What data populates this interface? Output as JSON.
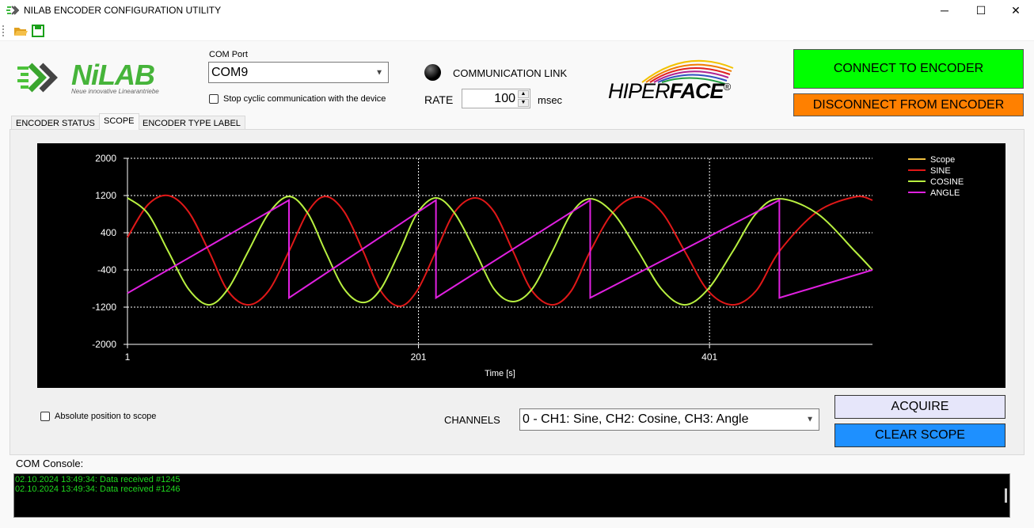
{
  "window": {
    "title": "NILAB ENCODER CONFIGURATION UTILITY",
    "minimize": "─",
    "maximize": "☐",
    "close": "✕"
  },
  "toolbar": {
    "open_icon": "folder-open-icon",
    "save_icon": "save-disk-icon"
  },
  "logo": {
    "text": "NiLAB",
    "tagline": "Neue innovative Linearantriebe"
  },
  "com": {
    "label": "COM Port",
    "value": "COM9",
    "stop_cyclic_label": "Stop cyclic communication with the device",
    "stop_cyclic_checked": false
  },
  "link": {
    "label": "COMMUNICATION LINK",
    "rate_label": "RATE",
    "rate_value": "100",
    "rate_unit": "msec"
  },
  "brand": {
    "text_light": "HIPER",
    "text_bold": "FACE",
    "reg": "®"
  },
  "buttons": {
    "connect": "CONNECT TO ENCODER",
    "disconnect": "DISCONNECT FROM ENCODER",
    "acquire": "ACQUIRE",
    "clear": "CLEAR SCOPE",
    "connect_color": "#00ff00",
    "disconnect_color": "#ff8000",
    "clear_color": "#1e90ff"
  },
  "tabs": [
    {
      "label": "ENCODER STATUS"
    },
    {
      "label": "SCOPE",
      "active": true
    },
    {
      "label": "ENCODER TYPE LABEL"
    }
  ],
  "scope": {
    "absolute_label": "Absolute position to scope",
    "absolute_checked": false,
    "channels_label": "CHANNELS",
    "channels_value": "0 - CH1: Sine, CH2: Cosine, CH3: Angle"
  },
  "console": {
    "label": "COM Console:",
    "lines": [
      "02.10.2024 13:49:34: Data received #1245",
      "02.10.2024 13:49:34: Data received #1246"
    ]
  },
  "chart_data": {
    "type": "line",
    "xlabel": "Time [s]",
    "ylabel": "",
    "xlim": [
      1,
      513
    ],
    "ylim": [
      -2000,
      2000
    ],
    "yticks": [
      "2000",
      "1200",
      "400",
      "-400",
      "-1200",
      "-2000"
    ],
    "xticks": [
      "1",
      "201",
      "401"
    ],
    "legend_position": "top-right",
    "grid": true,
    "series": [
      {
        "name": "Scope",
        "color": "#f0c040",
        "x": [],
        "y": []
      },
      {
        "name": "SINE",
        "color": "#e01818",
        "x": [
          1,
          15,
          29,
          43,
          57,
          70,
          84,
          98,
          112,
          125,
          137,
          150,
          163,
          175,
          188,
          200,
          213,
          226,
          240,
          253,
          266,
          279,
          293,
          306,
          319,
          335,
          352,
          368,
          384,
          400,
          417,
          433,
          449,
          475,
          501,
          513
        ],
        "y": [
          300,
          1000,
          1200,
          849,
          0,
          -849,
          -1150,
          -849,
          0,
          849,
          1180,
          849,
          0,
          -849,
          -1180,
          -849,
          0,
          849,
          1150,
          849,
          0,
          -849,
          -1150,
          -849,
          0,
          849,
          1170,
          849,
          0,
          -849,
          -1150,
          -849,
          0,
          849,
          1170,
          1100
        ]
      },
      {
        "name": "COSINE",
        "color": "#b8f040",
        "x": [
          1,
          15,
          29,
          43,
          57,
          70,
          84,
          98,
          112,
          125,
          137,
          150,
          163,
          175,
          188,
          200,
          213,
          226,
          240,
          253,
          266,
          279,
          293,
          306,
          319,
          335,
          352,
          368,
          384,
          400,
          417,
          433,
          449,
          475,
          501,
          513
        ],
        "y": [
          1150,
          813,
          0,
          -813,
          -1150,
          -813,
          0,
          813,
          1180,
          813,
          0,
          -813,
          -1100,
          -813,
          0,
          813,
          1150,
          813,
          0,
          -813,
          -1080,
          -813,
          0,
          813,
          1130,
          813,
          0,
          -813,
          -1150,
          -813,
          0,
          813,
          1130,
          813,
          0,
          -400
        ]
      },
      {
        "name": "ANGLE",
        "color": "#e020e0",
        "x": [
          1,
          112,
          112,
          213,
          213,
          319,
          319,
          449,
          449,
          513
        ],
        "y": [
          -900,
          1100,
          -1000,
          1100,
          -1000,
          1100,
          -1000,
          1100,
          -1000,
          -400
        ]
      }
    ]
  }
}
